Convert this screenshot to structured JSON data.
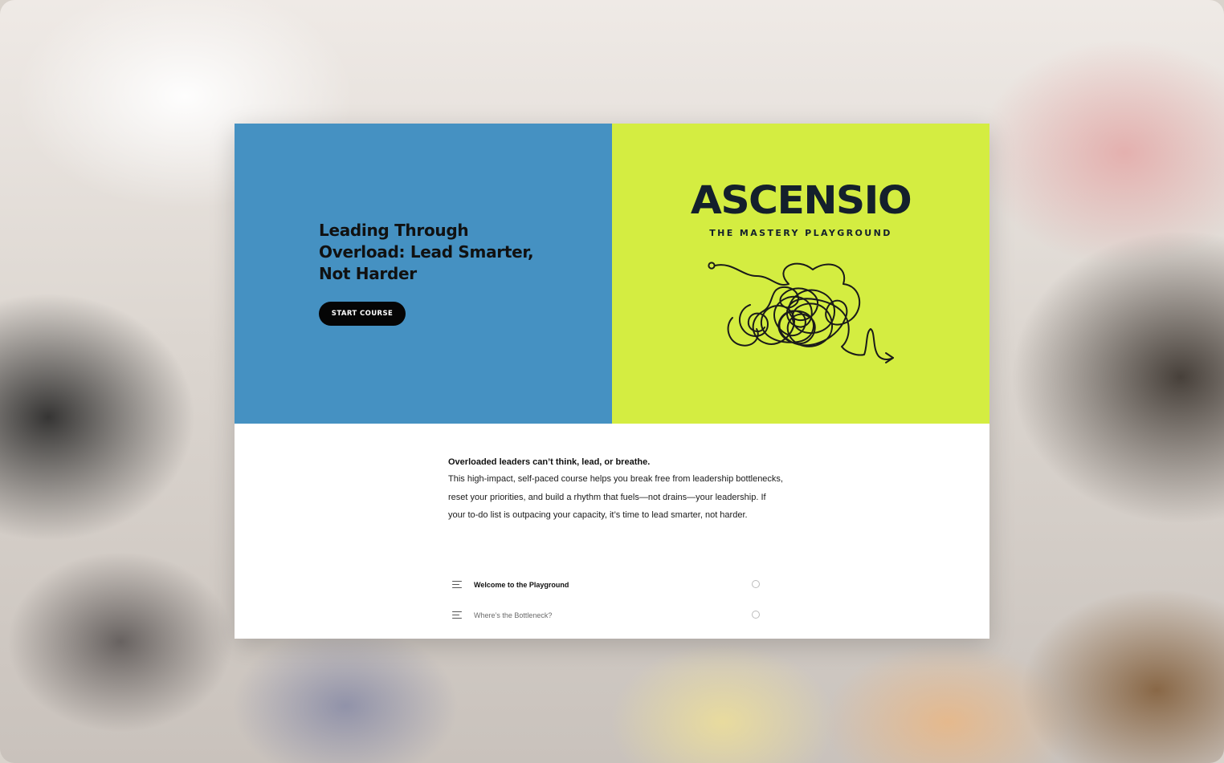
{
  "course": {
    "title": "Leading Through Overload: Lead Smarter, Not Harder",
    "start_label": "START COURSE"
  },
  "brand": {
    "name": "ASCENSIO",
    "tagline": "THE MASTERY PLAYGROUND",
    "scribble_icon": "tangled-scribble-arrow-icon"
  },
  "colors": {
    "hero_left": "#4591c2",
    "hero_right": "#d4ed41",
    "button": "#050505",
    "logo_text": "#14202c"
  },
  "intro": {
    "headline": "Overloaded leaders can’t think, lead, or breathe.",
    "body": "This high-impact, self-paced course helps you break free from leadership bottlenecks, reset your priorities, and build a rhythm that fuels—not drains—your leadership. If your to-do list is outpacing your capacity, it’s time to lead smarter, not harder."
  },
  "lessons": [
    {
      "label": "Welcome to the Playground",
      "icon": "text-lines-icon",
      "status": "incomplete"
    },
    {
      "label": "Where’s the Bottleneck?",
      "icon": "text-lines-icon",
      "status": "incomplete"
    }
  ]
}
